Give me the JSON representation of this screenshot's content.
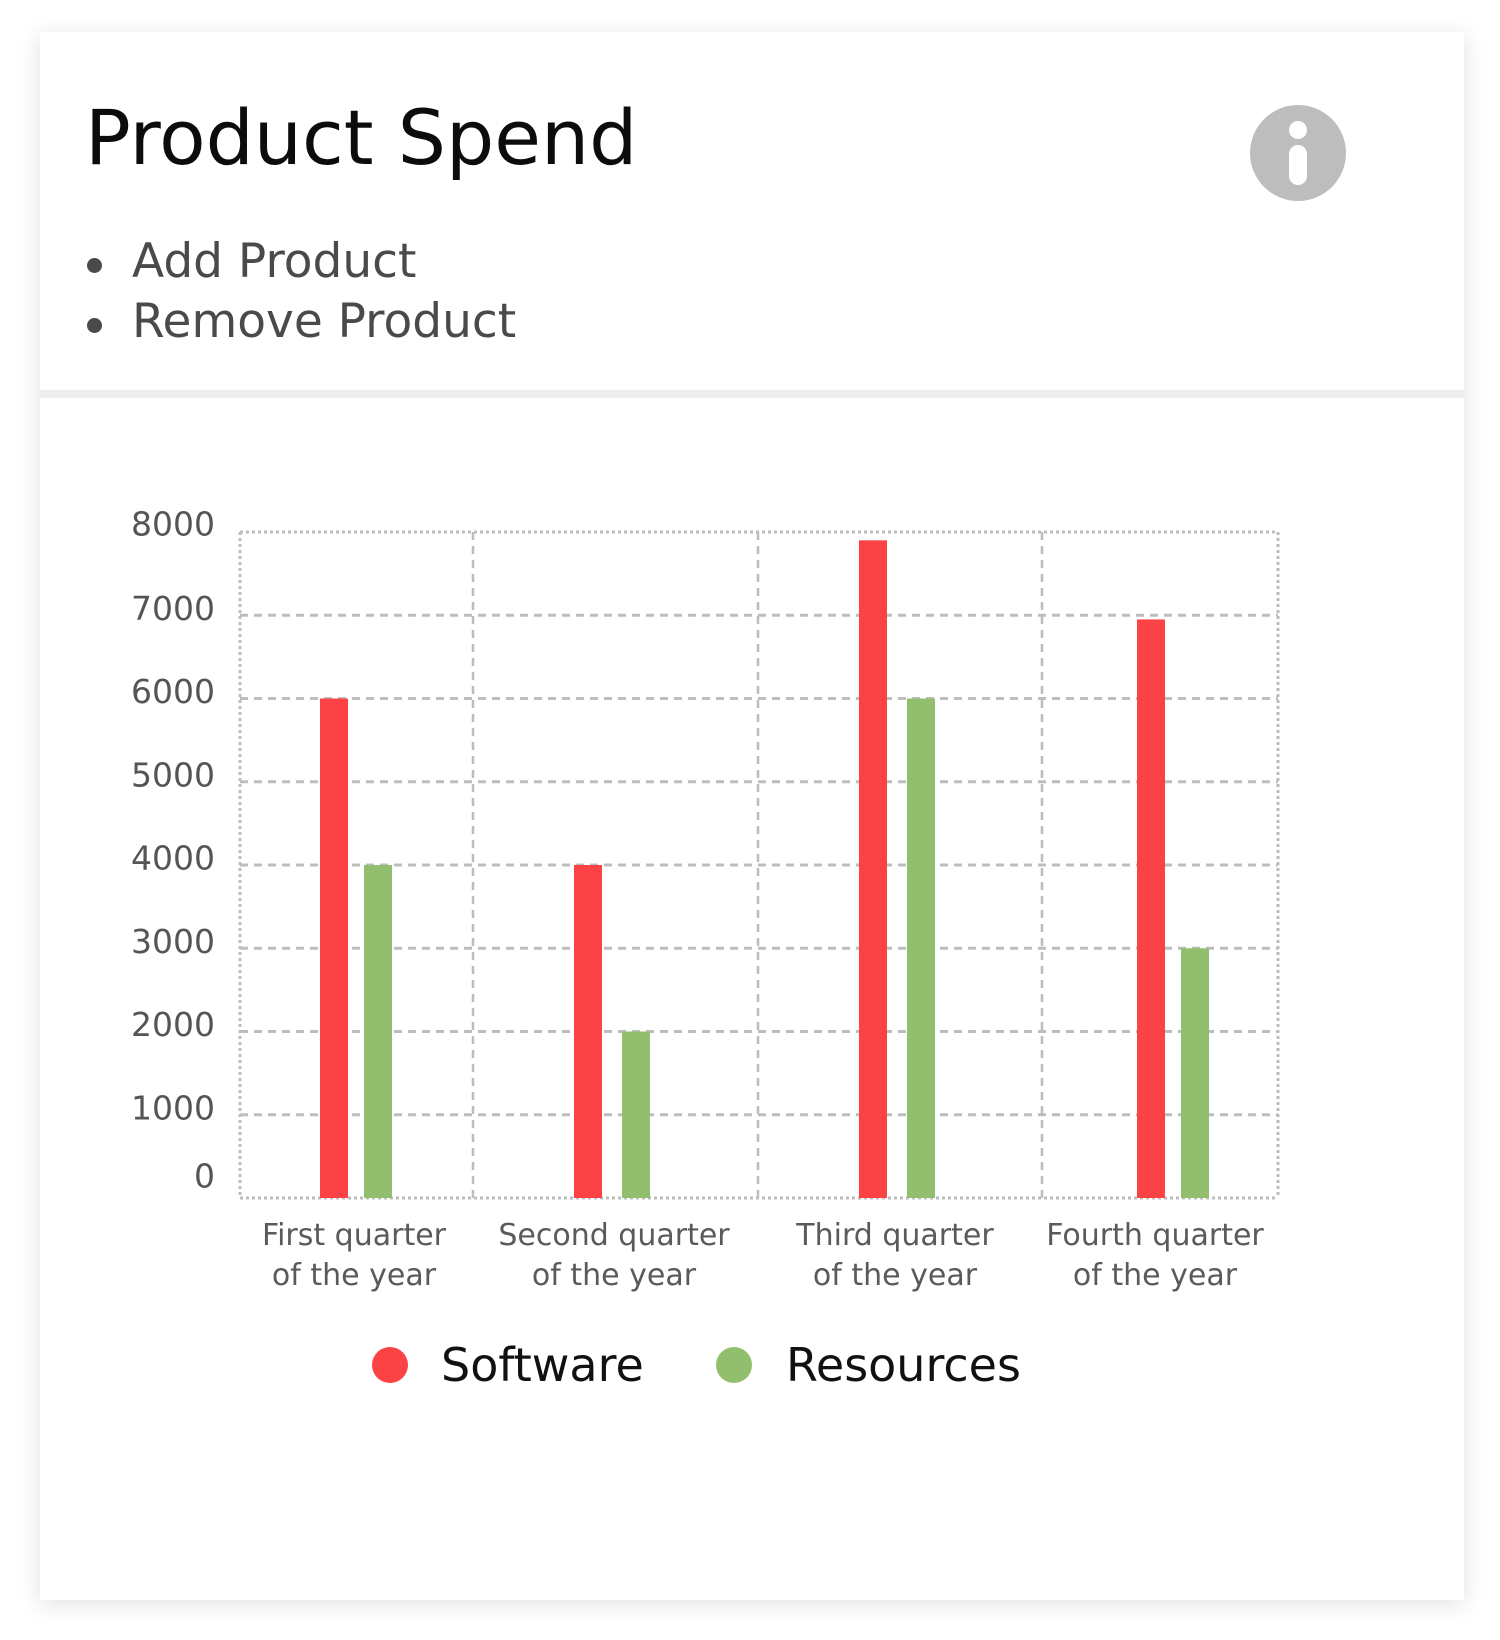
{
  "card": {
    "title": "Product Spend",
    "actions": [
      "Add Product",
      "Remove Product"
    ],
    "info_icon": "info-icon",
    "info_icon_color": "#bdbdbd"
  },
  "chart_data": {
    "type": "bar",
    "categories": [
      [
        "First quarter",
        "of the year"
      ],
      [
        "Second quarter",
        "of the year"
      ],
      [
        "Third quarter",
        "of the year"
      ],
      [
        "Fourth quarter",
        "of the year"
      ]
    ],
    "series": [
      {
        "name": "Software",
        "color": "#fb4244",
        "values": [
          6000,
          4000,
          7900,
          6950
        ]
      },
      {
        "name": "Resources",
        "color": "#92bf6d",
        "values": [
          4000,
          2000,
          6000,
          3000
        ]
      }
    ],
    "yticks": [
      0,
      1000,
      2000,
      3000,
      4000,
      5000,
      6000,
      7000,
      8000
    ],
    "ylim": [
      0,
      8000
    ],
    "grid": true,
    "legend": "bottom"
  }
}
